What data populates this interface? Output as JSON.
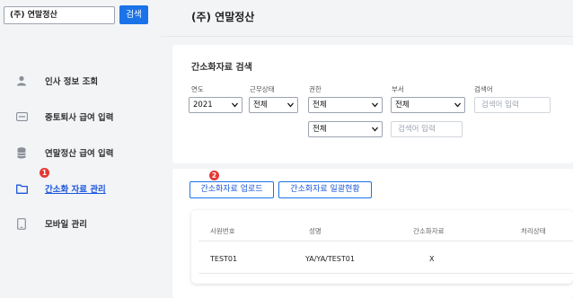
{
  "sidebar": {
    "company_value": "(주) 연말정산",
    "search_label": "검색",
    "items": [
      {
        "label": "인사 정보 조회",
        "icon": "person-icon"
      },
      {
        "label": "중토퇴사 급여 입력",
        "icon": "card-icon"
      },
      {
        "label": "연말정산 급여 입력",
        "icon": "database-icon"
      },
      {
        "label": "간소화 자료 관리",
        "icon": "folder-icon"
      },
      {
        "label": "모바일 관리",
        "icon": "mobile-icon"
      }
    ],
    "active_index": 3
  },
  "header": {
    "title": "(주) 연말정산"
  },
  "search_panel": {
    "title": "간소화자료 검색",
    "fields": {
      "year": {
        "label": "연도",
        "value": "2021"
      },
      "work_status": {
        "label": "근무상태",
        "value": "전체"
      },
      "permission": {
        "label": "권한",
        "value": "전체",
        "value2": "전체"
      },
      "department": {
        "label": "부서",
        "value": "전체",
        "placeholder": "검색어 입력"
      },
      "keyword": {
        "label": "검색어",
        "placeholder": "검색어 입력"
      }
    }
  },
  "actions": {
    "upload_label": "간소화자료 업로드",
    "overview_label": "간소화자료 일괄현황"
  },
  "table": {
    "columns": [
      "사원번호",
      "성명",
      "간소화자료",
      "처리상태"
    ],
    "rows": [
      [
        "TEST01",
        "YA/YA/TEST01",
        "X",
        ""
      ]
    ]
  },
  "badges": {
    "one": "1",
    "two": "2"
  },
  "colors": {
    "accent": "#1a73e8",
    "badge": "#e53935",
    "active_text": "#1a56db"
  }
}
